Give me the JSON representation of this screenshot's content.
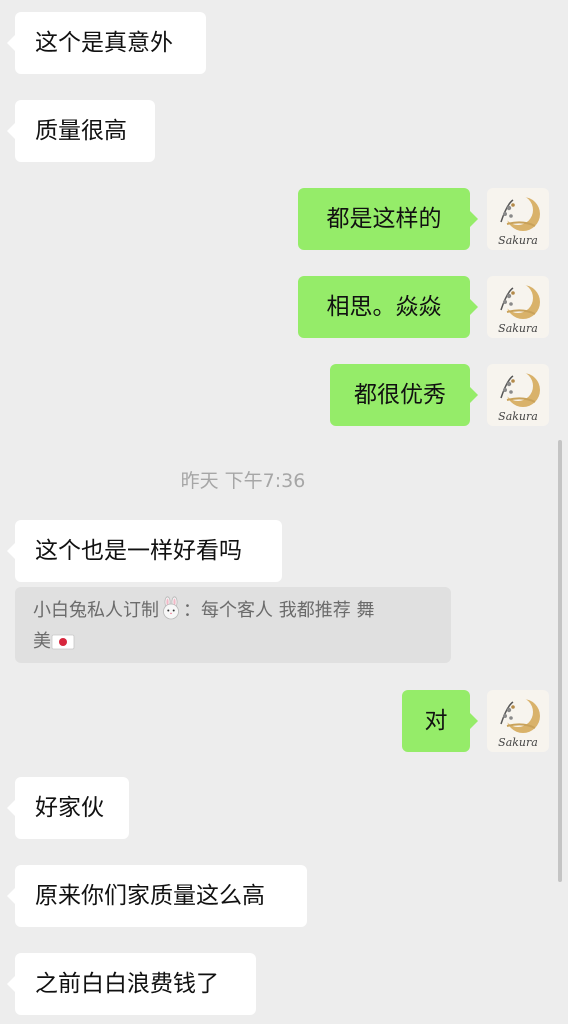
{
  "messages": [
    {
      "side": "left",
      "text": "这个是真意外"
    },
    {
      "side": "left",
      "text": "质量很高"
    },
    {
      "side": "right",
      "text": "都是这样的"
    },
    {
      "side": "right",
      "text": "相思。焱焱"
    },
    {
      "side": "right",
      "text": "都很优秀"
    },
    {
      "side": "left",
      "text": "这个也是一样好看吗"
    },
    {
      "side": "right",
      "text": "对"
    },
    {
      "side": "left",
      "text": "好家伙"
    },
    {
      "side": "left",
      "text": "原来你们家质量这么高"
    },
    {
      "side": "left",
      "text": "之前白白浪费钱了"
    }
  ],
  "timestamp": "昨天 下午7:36",
  "quote": {
    "sender": "小白兔私人订制",
    "sender_emoji": "rabbit-face-emoji",
    "colon": "：",
    "text_line1": "每个客人 我都推荐 舞",
    "text_line2": "美",
    "trailing_emoji": "japan-flag-emoji"
  },
  "avatar": {
    "icon": "sakura-logo-icon",
    "label": "Sakura"
  },
  "colors": {
    "background": "#ededed",
    "left_bubble": "#ffffff",
    "right_bubble": "#95ec69",
    "quote_background": "#e0e0e0"
  }
}
